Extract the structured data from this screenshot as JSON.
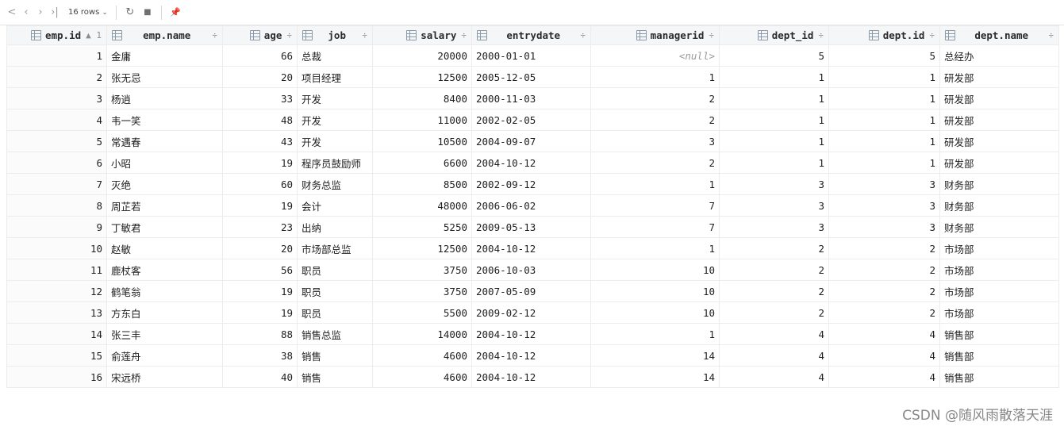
{
  "toolbar": {
    "prev_icon": "‹",
    "next_icon": "›",
    "last_icon": "›|",
    "rows_label": "16 rows",
    "rows_chevron": "⌄",
    "reload_icon": "↻",
    "stop_icon": "■",
    "pin_icon": "📌"
  },
  "columns": [
    {
      "label": "emp.id",
      "sort": "▲ 1"
    },
    {
      "label": "emp.name",
      "sort": "÷"
    },
    {
      "label": "age",
      "sort": "÷"
    },
    {
      "label": "job",
      "sort": "÷"
    },
    {
      "label": "salary",
      "sort": "÷"
    },
    {
      "label": "entrydate",
      "sort": "÷"
    },
    {
      "label": "managerid",
      "sort": "÷"
    },
    {
      "label": "dept_id",
      "sort": "÷"
    },
    {
      "label": "dept.id",
      "sort": "÷"
    },
    {
      "label": "dept.name",
      "sort": "÷"
    }
  ],
  "null_text": "<null>",
  "rows": [
    [
      "1",
      "金庸",
      "66",
      "总裁",
      "20000",
      "2000-01-01",
      null,
      "5",
      "5",
      "总经办"
    ],
    [
      "2",
      "张无忌",
      "20",
      "项目经理",
      "12500",
      "2005-12-05",
      "1",
      "1",
      "1",
      "研发部"
    ],
    [
      "3",
      "杨逍",
      "33",
      "开发",
      "8400",
      "2000-11-03",
      "2",
      "1",
      "1",
      "研发部"
    ],
    [
      "4",
      "韦一笑",
      "48",
      "开发",
      "11000",
      "2002-02-05",
      "2",
      "1",
      "1",
      "研发部"
    ],
    [
      "5",
      "常遇春",
      "43",
      "开发",
      "10500",
      "2004-09-07",
      "3",
      "1",
      "1",
      "研发部"
    ],
    [
      "6",
      "小昭",
      "19",
      "程序员鼓励师",
      "6600",
      "2004-10-12",
      "2",
      "1",
      "1",
      "研发部"
    ],
    [
      "7",
      "灭绝",
      "60",
      "财务总监",
      "8500",
      "2002-09-12",
      "1",
      "3",
      "3",
      "财务部"
    ],
    [
      "8",
      "周芷若",
      "19",
      "会计",
      "48000",
      "2006-06-02",
      "7",
      "3",
      "3",
      "财务部"
    ],
    [
      "9",
      "丁敏君",
      "23",
      "出纳",
      "5250",
      "2009-05-13",
      "7",
      "3",
      "3",
      "财务部"
    ],
    [
      "10",
      "赵敏",
      "20",
      "市场部总监",
      "12500",
      "2004-10-12",
      "1",
      "2",
      "2",
      "市场部"
    ],
    [
      "11",
      "鹿杖客",
      "56",
      "职员",
      "3750",
      "2006-10-03",
      "10",
      "2",
      "2",
      "市场部"
    ],
    [
      "12",
      "鹤笔翁",
      "19",
      "职员",
      "3750",
      "2007-05-09",
      "10",
      "2",
      "2",
      "市场部"
    ],
    [
      "13",
      "方东白",
      "19",
      "职员",
      "5500",
      "2009-02-12",
      "10",
      "2",
      "2",
      "市场部"
    ],
    [
      "14",
      "张三丰",
      "88",
      "销售总监",
      "14000",
      "2004-10-12",
      "1",
      "4",
      "4",
      "销售部"
    ],
    [
      "15",
      "俞莲舟",
      "38",
      "销售",
      "4600",
      "2004-10-12",
      "14",
      "4",
      "4",
      "销售部"
    ],
    [
      "16",
      "宋远桥",
      "40",
      "销售",
      "4600",
      "2004-10-12",
      "14",
      "4",
      "4",
      "销售部"
    ]
  ],
  "watermark": "CSDN @随风雨散落天涯"
}
